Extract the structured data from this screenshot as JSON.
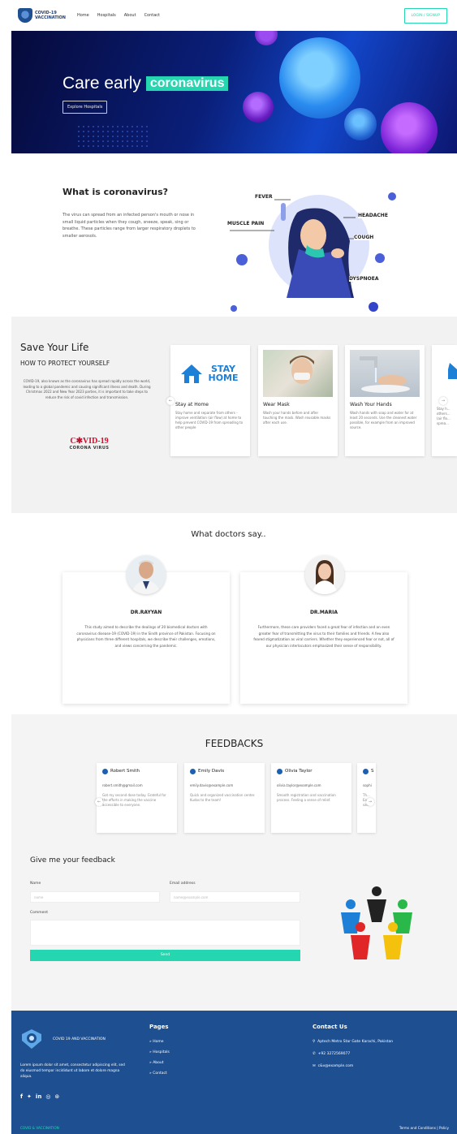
{
  "nav": {
    "logo_text_line1": "COVID-19",
    "logo_text_line2": "VACCINATION",
    "links": [
      "Home",
      "Hospitals",
      "About",
      "Contact"
    ],
    "login_label": "LOGIN / SIGNUP"
  },
  "hero": {
    "title_prefix": "Care early",
    "title_highlight": "coronavirus",
    "button_label": "Explore Hospitals",
    "accent_color": "#25d7b0"
  },
  "what_is": {
    "title": "What is coronavirus?",
    "text": "The virus can spread from an infected person's mouth or nose in small liquid particles when they cough, sneeze, speak, sing or breathe. These particles range from larger respiratory droplets to smaller aerosols.",
    "symptoms": [
      "FEVER",
      "HEADACHE",
      "MUSCLE PAIN",
      "COUGH",
      "DYSPNOEA"
    ]
  },
  "save": {
    "title": "Save Your Life",
    "subtitle": "HOW TO PROTECT YOURSELF",
    "text": "COVID-19, also known as the coronavirus has spread rapidly across the world, leading to a global pandemic and causing significant illness and death. During Christmas 2022 and New Year 2023 parties, it is important to take steps to reduce the risk of covid infection and transmission.",
    "covid_logo_main": "C✱VID-19",
    "covid_logo_sub": "CORONA VIRUS",
    "stay_home_img": "STAY HOME",
    "cards": [
      {
        "title": "Stay at Home",
        "text": "Stay home and separate from others - improve ventilation (air flow) at home to help prevent COVID-19 from spreading to other people"
      },
      {
        "title": "Wear Mask",
        "text": "Wash your hands before and after touching the mask. Wash reusable masks after each use."
      },
      {
        "title": "Wash Your Hands",
        "text": "Wash hands with soap and water for at least 20 seconds. Use the cleanest water possible, for example from an improved source."
      },
      {
        "title": "Stay",
        "text": "Stay h... others... (air flo... sprea..."
      }
    ]
  },
  "doctors": {
    "title": "What doctors say..",
    "items": [
      {
        "name": "DR.RAYYAN",
        "text": "This study aimed to describe the dealings of 20 biomedical doctors with coronavirus disease-19 (COVID-19) in the Sindh province of Pakistan. Focusing on physicians from three different hospitals, we describe their challenges, emotions, and views concerning the pandemic."
      },
      {
        "name": "DR.MARIA",
        "text": "Furthermore, these care providers faced a great fear of infection and an even greater fear of transmitting the virus to their families and friends. A few also feared stigmatization as viral carriers. Whether they experienced fear or not, all of our physician interlocutors emphasized their sense of responsibility."
      }
    ]
  },
  "feedbacks": {
    "title": "FEEDBACKS",
    "items": [
      {
        "name": "Robert Smith",
        "email": "robert.smith@gmail.com",
        "text": "Got my second dose today. Grateful for the efforts in making the vaccine accessible to everyone."
      },
      {
        "name": "Emily Davis",
        "email": "emily.davis@example.com",
        "text": "Quick and organized vaccination center. Kudos to the team!"
      },
      {
        "name": "Olivia Taylor",
        "email": "olivia.taylor@example.com",
        "text": "Smooth registration and vaccination process. Feeling a sense of relief."
      },
      {
        "name": "S",
        "email": "sophi",
        "text": "Th... Eas... saf..."
      }
    ],
    "form": {
      "title": "Give me your feedback",
      "name_label": "Name",
      "name_placeholder": "name",
      "email_label": "Email address",
      "email_placeholder": "name@example.com",
      "comment_label": "Comment",
      "send_label": "Send"
    }
  },
  "footer": {
    "brand": "COVID 19 AND VACCINATION",
    "lorem": "Lorem ipsum dolor sit amet, consectetur adipiscing elit, sed do eiusmod tempor incididunt ut labore et dolore magna aliqua.",
    "social": [
      "f",
      "t",
      "in",
      "ig",
      "dr"
    ],
    "pages_title": "Pages",
    "pages": [
      "Home",
      "Hospitals",
      "About",
      "Contact"
    ],
    "contact_title": "Contact Us",
    "address": "Aptech Metro Star Gate Karachi, Pakistan",
    "phone": "+92 3272569077",
    "email": "c&v@example.com",
    "bottom_left": "COVID & VACCINATION",
    "bottom_right": "Terms and Conditions  |  Policy"
  }
}
